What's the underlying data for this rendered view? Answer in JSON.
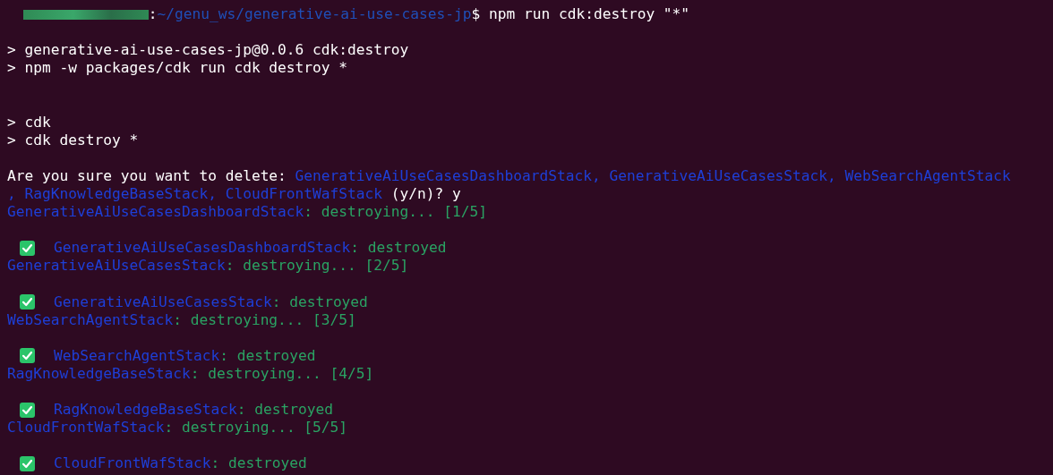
{
  "terminal": {
    "lines": [
      {
        "kind": "text",
        "segments": [
          {
            "kind": "redacted"
          },
          {
            "kind": "plain",
            "text": ":"
          },
          {
            "kind": "path",
            "text": "~/genu_ws/generative-ai-use-cases-jp"
          },
          {
            "kind": "plain",
            "text": "$ npm run cdk:destroy \"*\""
          }
        ]
      },
      {
        "kind": "blank"
      },
      {
        "kind": "text",
        "segments": [
          {
            "kind": "plain",
            "text": "> generative-ai-use-cases-jp@0.0.6 cdk:destroy"
          }
        ]
      },
      {
        "kind": "text",
        "segments": [
          {
            "kind": "plain",
            "text": "> npm -w packages/cdk run cdk destroy *"
          }
        ]
      },
      {
        "kind": "blank"
      },
      {
        "kind": "blank"
      },
      {
        "kind": "text",
        "segments": [
          {
            "kind": "plain",
            "text": "> cdk"
          }
        ]
      },
      {
        "kind": "text",
        "segments": [
          {
            "kind": "plain",
            "text": "> cdk destroy *"
          }
        ]
      },
      {
        "kind": "blank"
      },
      {
        "kind": "text",
        "segments": [
          {
            "kind": "plain",
            "text": "Are you sure you want to delete: "
          },
          {
            "kind": "stack",
            "text": "GenerativeAiUseCasesDashboardStack, GenerativeAiUseCasesStack, WebSearchAgentStack"
          }
        ]
      },
      {
        "kind": "text",
        "segments": [
          {
            "kind": "stack",
            "text": ", RagKnowledgeBaseStack, CloudFrontWafStack"
          },
          {
            "kind": "plain",
            "text": " (y/n)? y"
          }
        ]
      },
      {
        "kind": "text",
        "segments": [
          {
            "kind": "stack",
            "text": "GenerativeAiUseCasesDashboardStack"
          },
          {
            "kind": "status",
            "text": ": destroying... [1/5]"
          }
        ]
      },
      {
        "kind": "blank"
      },
      {
        "kind": "text",
        "segments": [
          {
            "kind": "check"
          },
          {
            "kind": "stack",
            "text": "GenerativeAiUseCasesDashboardStack"
          },
          {
            "kind": "status",
            "text": ": destroyed"
          }
        ]
      },
      {
        "kind": "text",
        "segments": [
          {
            "kind": "stack",
            "text": "GenerativeAiUseCasesStack"
          },
          {
            "kind": "status",
            "text": ": destroying... [2/5]"
          }
        ]
      },
      {
        "kind": "blank"
      },
      {
        "kind": "text",
        "segments": [
          {
            "kind": "check"
          },
          {
            "kind": "stack",
            "text": "GenerativeAiUseCasesStack"
          },
          {
            "kind": "status",
            "text": ": destroyed"
          }
        ]
      },
      {
        "kind": "text",
        "segments": [
          {
            "kind": "stack",
            "text": "WebSearchAgentStack"
          },
          {
            "kind": "status",
            "text": ": destroying... [3/5]"
          }
        ]
      },
      {
        "kind": "blank"
      },
      {
        "kind": "text",
        "segments": [
          {
            "kind": "check"
          },
          {
            "kind": "stack",
            "text": "WebSearchAgentStack"
          },
          {
            "kind": "status",
            "text": ": destroyed"
          }
        ]
      },
      {
        "kind": "text",
        "segments": [
          {
            "kind": "stack",
            "text": "RagKnowledgeBaseStack"
          },
          {
            "kind": "status",
            "text": ": destroying... [4/5]"
          }
        ]
      },
      {
        "kind": "blank"
      },
      {
        "kind": "text",
        "segments": [
          {
            "kind": "check"
          },
          {
            "kind": "stack",
            "text": "RagKnowledgeBaseStack"
          },
          {
            "kind": "status",
            "text": ": destroyed"
          }
        ]
      },
      {
        "kind": "text",
        "segments": [
          {
            "kind": "stack",
            "text": "CloudFrontWafStack"
          },
          {
            "kind": "status",
            "text": ": destroying... [5/5]"
          }
        ]
      },
      {
        "kind": "blank"
      },
      {
        "kind": "text",
        "segments": [
          {
            "kind": "check"
          },
          {
            "kind": "stack",
            "text": "CloudFrontWafStack"
          },
          {
            "kind": "status",
            "text": ": destroyed"
          }
        ]
      }
    ]
  }
}
